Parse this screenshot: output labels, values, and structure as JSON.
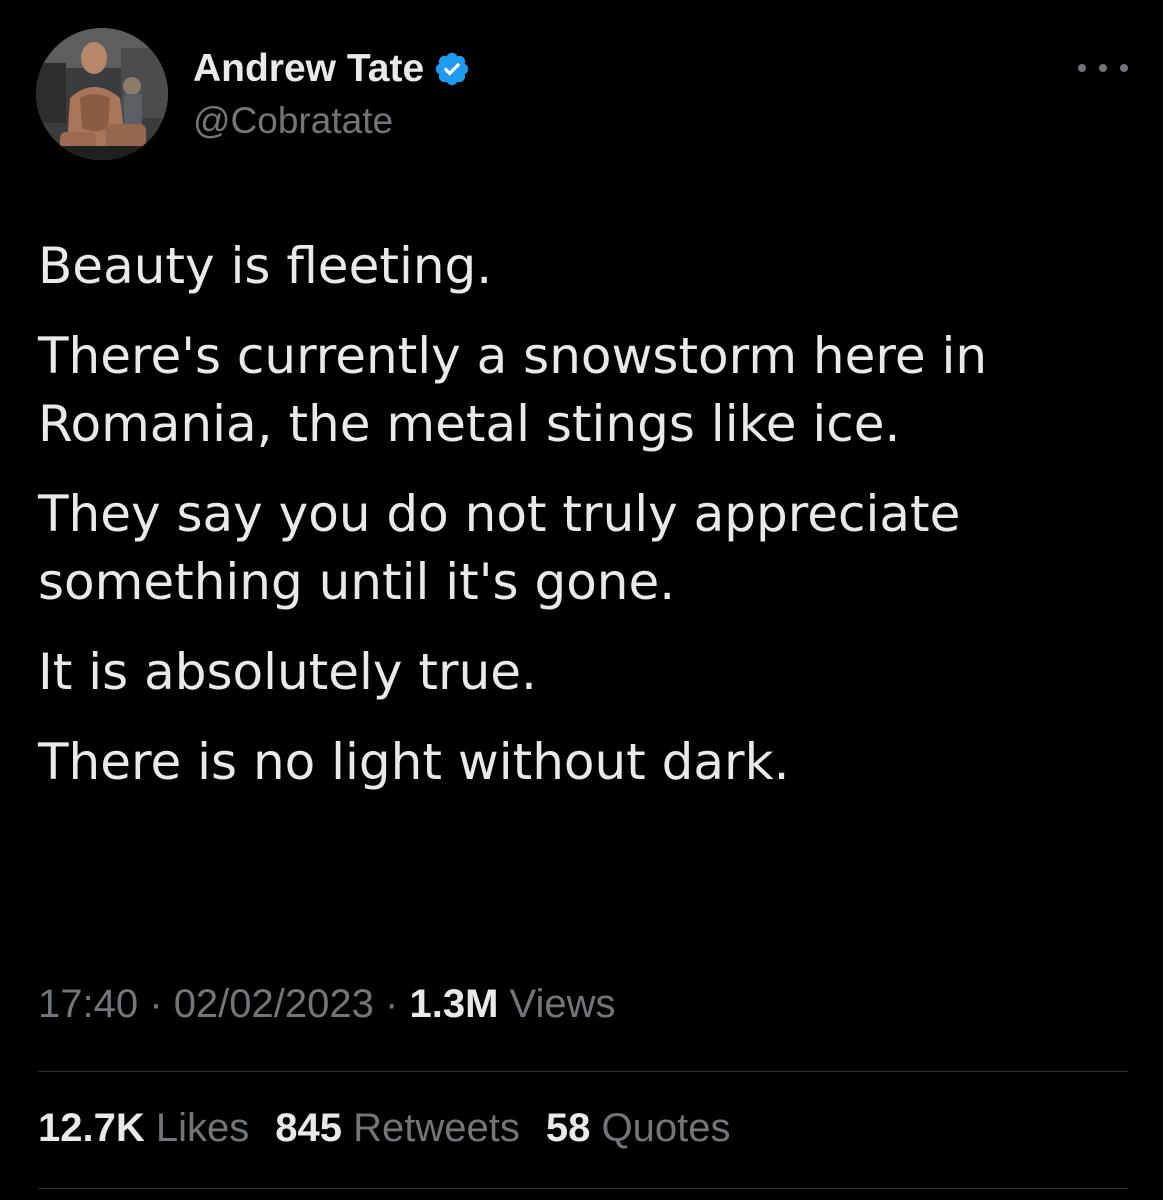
{
  "author": {
    "display_name": "Andrew Tate",
    "handle": "@Cobratate",
    "verified_icon": "verified-badge-icon",
    "avatar_icon": "profile-photo"
  },
  "more_icon": "more-options-icon",
  "tweet": {
    "paragraphs": [
      "Beauty is fleeting.",
      "There's currently a snowstorm here in Romania, the metal stings like ice.",
      "They say you do not truly appreciate something until it's gone.",
      "It is absolutely true.",
      "There is no light without dark."
    ]
  },
  "meta": {
    "time": "17:40",
    "separator": "·",
    "date": "02/02/2023",
    "views_count": "1.3M",
    "views_label": "Views"
  },
  "stats": {
    "likes_count": "12.7K",
    "likes_label": "Likes",
    "retweets_count": "845",
    "retweets_label": "Retweets",
    "quotes_count": "58",
    "quotes_label": "Quotes"
  },
  "colors": {
    "background": "#000000",
    "text_primary": "#e7e9ea",
    "text_secondary": "#71767b",
    "divider": "#2f3336",
    "verified_blue": "#1d9bf0"
  }
}
